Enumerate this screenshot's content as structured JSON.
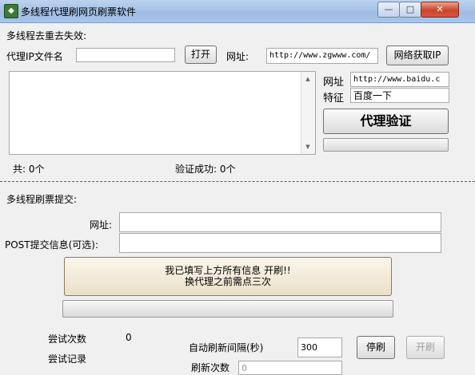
{
  "window": {
    "title": "多线程代理刷网页刷票软件",
    "min_glyph": "—",
    "max_glyph": "□",
    "close_glyph": "✕"
  },
  "proxy_section": {
    "heading": "多线程去重去失效:",
    "file_label": "代理IP文件名",
    "file_value": "",
    "open_button": "打开",
    "url_label": "网址:",
    "url_value": "http://www.zgwww.com/",
    "fetch_button": "网络获取IP",
    "list_value": "",
    "verify_url_label": "网址",
    "verify_url_value": "http://www.baidu.c",
    "feature_label": "特征",
    "feature_value": "百度一下",
    "verify_button": "代理验证",
    "verify_progress": 0,
    "total_text": "共: 0个",
    "success_text": "验证成功: 0个"
  },
  "vote_section": {
    "heading": "多线程刷票提交:",
    "url_label": "网址:",
    "url_value": "",
    "post_label": "POST提交信息(可选):",
    "post_value": "",
    "start_line1": "我已填写上方所有信息 开刷!!",
    "start_line2": "换代理之前需点三次",
    "main_progress": 0,
    "try_count_label": "尝试次数",
    "try_count_value": "0",
    "try_log_label": "尝试记录",
    "interval_label": "自动刷新间隔(秒)",
    "interval_value": "300",
    "stop_button": "停刷",
    "start_button": "开刷",
    "refresh_count_label": "刷新次数",
    "refresh_count_value": "0"
  },
  "colors": {
    "titlebar": "#a9c5e8",
    "window_bg": "#f0f0f0",
    "start_button_bg": "#f5eee0"
  }
}
